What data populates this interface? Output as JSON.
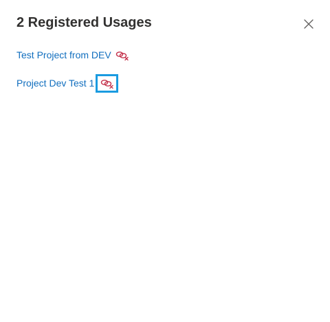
{
  "panel": {
    "title": "2 Registered Usages"
  },
  "usages": [
    {
      "label": "Test Project from DEV",
      "icon": "unlink-icon"
    },
    {
      "label": "Project Dev Test 1",
      "icon": "unlink-icon"
    }
  ],
  "colors": {
    "link": "#106ebe",
    "unlink_icon": "#c4314b",
    "focus_ring": "#1a9be0",
    "title": "#323130"
  }
}
